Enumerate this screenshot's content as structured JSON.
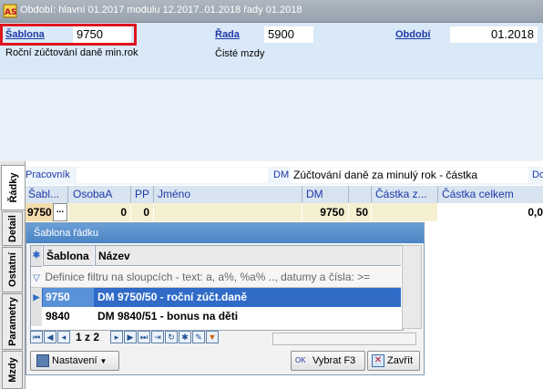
{
  "titlebar": {
    "text": "Období: hlavní 01.2017 modulu 12.2017..01.2018 řady 01.2018"
  },
  "header": {
    "sablona_label": "Šablona",
    "sablona_value": "9750",
    "rada_label": "Řada",
    "rada_value": "5900",
    "obdobi_label": "Období",
    "obdobi_value": "01.2018",
    "description": "Roční zúčtování daně min.rok",
    "rada_name": "Čisté mzdy"
  },
  "tabs": [
    {
      "label": "Řádky"
    },
    {
      "label": "Detail"
    },
    {
      "label": "Ostatní"
    },
    {
      "label": "Parametry"
    },
    {
      "label": "Mzdy"
    }
  ],
  "grid": {
    "pracovnik_label": "Pracovník",
    "dm_label": "DM",
    "dm_text": "Zúčtování daně za minulý rok - částka",
    "trailing_label": "Do",
    "columns": [
      "Šabl...",
      "OsobaA",
      "PP",
      "Jméno",
      "DM",
      "Částka z...",
      "Částka celkem"
    ],
    "row": {
      "sablona": "9750",
      "ellipsis": "...",
      "osoba": "0",
      "pp": "0",
      "dm": "9750",
      "col50": "50",
      "celkem": "0,0"
    }
  },
  "popup": {
    "title": "Šablona řádku",
    "columns": [
      "Šablona",
      "Název"
    ],
    "filter_text": "Definice filtru na sloupcích - text: a, a%, %a% .., datumy a čísla: >=",
    "rows": [
      {
        "sablona": "9750",
        "nazev": "DM 9750/50 - roční zúčt.daně",
        "selected": true
      },
      {
        "sablona": "9840",
        "nazev": "DM 9840/51 - bonus na děti",
        "selected": false
      }
    ],
    "page_indicator": "1 z 2",
    "settings_button": "Nastavení",
    "select_button": "Vybrat F3",
    "close_button": "Zavřít"
  },
  "colors": {
    "accent": "#1e3aa8",
    "selection": "#2f6bc7",
    "highlight_box": "#e0141e"
  }
}
